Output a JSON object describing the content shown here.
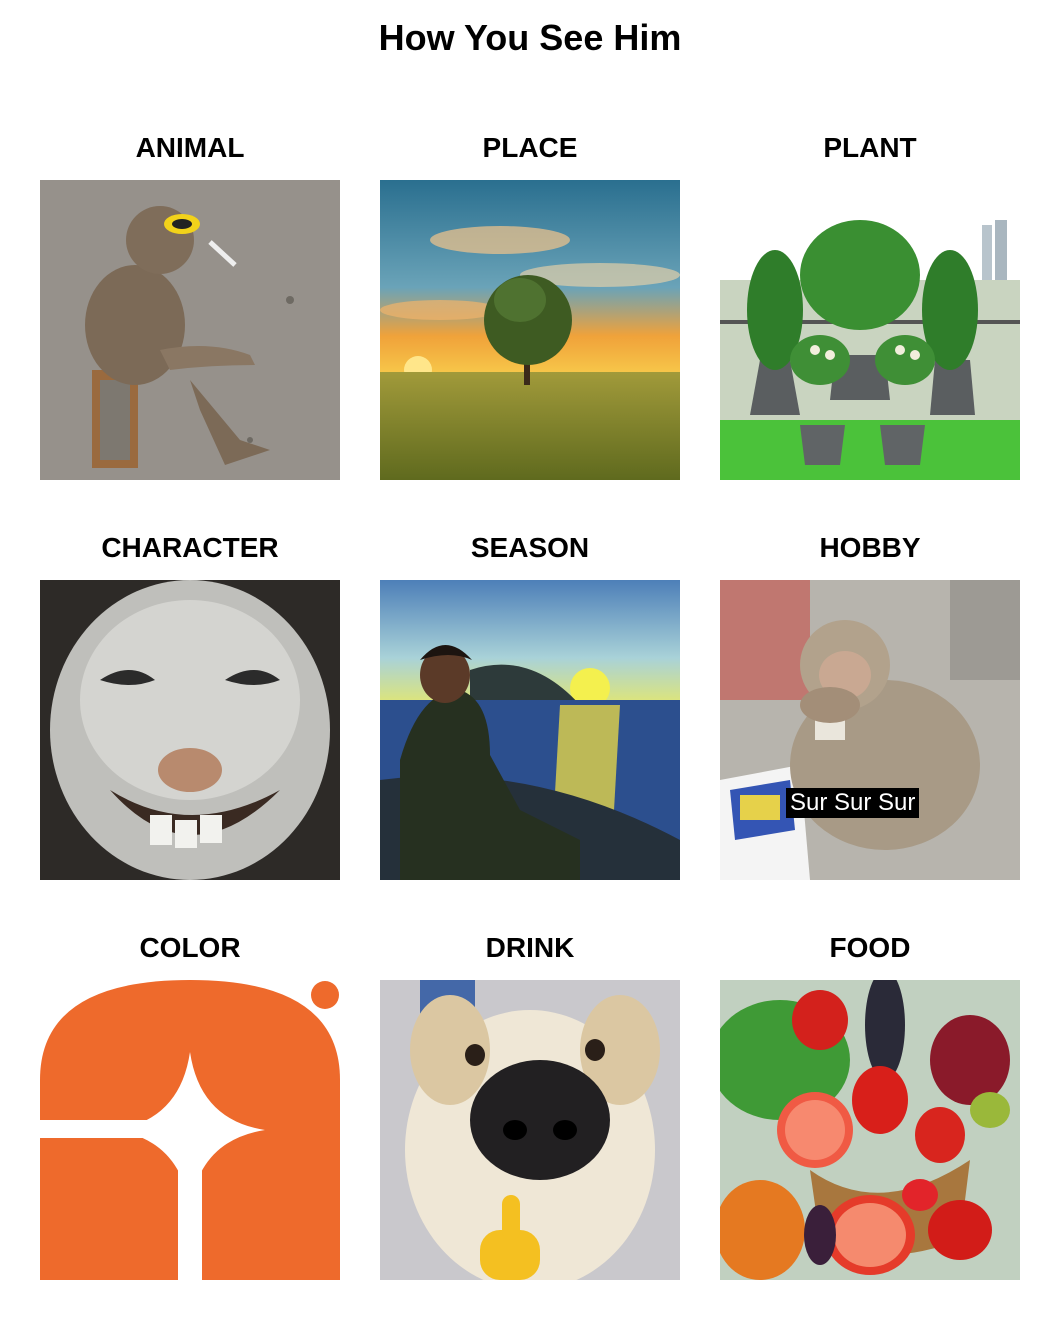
{
  "title": "How You See Him",
  "cells": [
    {
      "label": "ANIMAL",
      "image": "monkey-sitting-with-sunglasses-and-cigarette"
    },
    {
      "label": "PLACE",
      "image": "sunset-tree-in-field"
    },
    {
      "label": "PLANT",
      "image": "potted-palm-plants-on-balcony"
    },
    {
      "label": "CHARACTER",
      "image": "smiling-white-animal-closeup"
    },
    {
      "label": "SEASON",
      "image": "man-watching-sunset-over-lake-painting"
    },
    {
      "label": "HOBBY",
      "image": "monkey-sniffing-packet",
      "caption": "Sur Sur Sur"
    },
    {
      "label": "COLOR",
      "image": "orange-logo-with-white-star"
    },
    {
      "label": "DRINK",
      "image": "puppy-nose-closeup-thumbs-up"
    },
    {
      "label": "FOOD",
      "image": "basket-of-fruits-and-vegetables"
    }
  ]
}
